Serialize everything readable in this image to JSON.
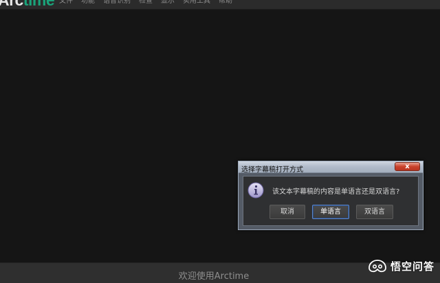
{
  "app": {
    "logo_main": "Arc",
    "logo_accent": "time"
  },
  "menu": {
    "items": [
      "文件",
      "功能",
      "语音识别",
      "检查",
      "显示",
      "实用工具",
      "帮助"
    ]
  },
  "status": {
    "text": "欢迎使用Arctime"
  },
  "watermark": {
    "text": "悟空问答"
  },
  "dialog": {
    "title": "选择字幕稿打开方式",
    "close_label": "x",
    "message": "该文本字幕稿的内容是单语言还是双语言?",
    "buttons": {
      "cancel": "取消",
      "single": "单语言",
      "double": "双语言"
    }
  },
  "colors": {
    "background": "#151515",
    "accent": "#1aa37a",
    "close_button": "#c9422b",
    "default_button_border": "#5c86c8"
  },
  "icons": {
    "dialog_icon": "info-icon",
    "close": "close-icon"
  }
}
